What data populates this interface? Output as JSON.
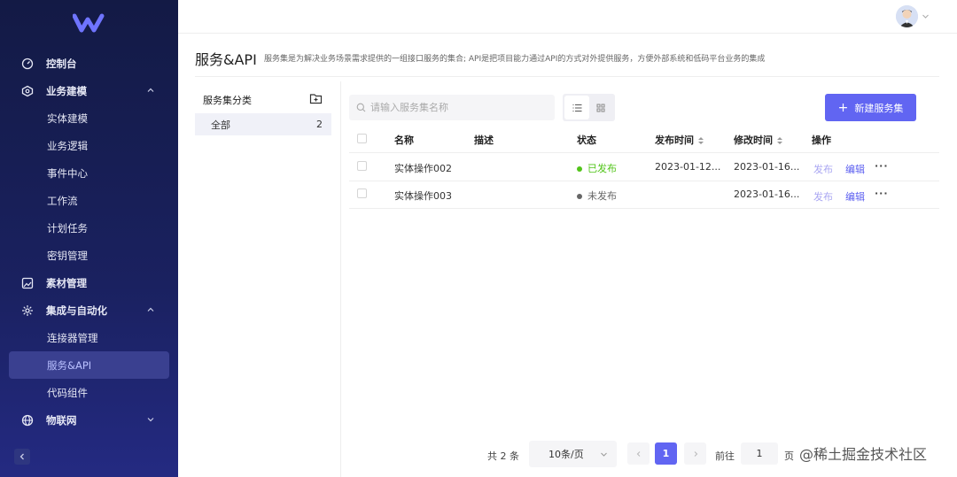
{
  "sidebar": {
    "items": [
      {
        "label": "控制台",
        "icon": "dashboard-icon",
        "type": "group"
      },
      {
        "label": "业务建模",
        "icon": "model-icon",
        "type": "group",
        "expanded": true
      },
      {
        "label": "实体建模",
        "type": "sub"
      },
      {
        "label": "业务逻辑",
        "type": "sub"
      },
      {
        "label": "事件中心",
        "type": "sub"
      },
      {
        "label": "工作流",
        "type": "sub"
      },
      {
        "label": "计划任务",
        "type": "sub"
      },
      {
        "label": "密钥管理",
        "type": "sub"
      },
      {
        "label": "素材管理",
        "icon": "image-icon",
        "type": "group"
      },
      {
        "label": "集成与自动化",
        "icon": "integration-icon",
        "type": "group",
        "expanded": true
      },
      {
        "label": "连接器管理",
        "type": "sub"
      },
      {
        "label": "服务&API",
        "type": "sub",
        "active": true
      },
      {
        "label": "代码组件",
        "type": "sub"
      },
      {
        "label": "物联网",
        "icon": "globe-icon",
        "type": "group",
        "expanded": false
      }
    ]
  },
  "page": {
    "title": "服务&API",
    "description": "服务集是为解决业务场景需求提供的一组接口服务的集合; API是把项目能力通过API的方式对外提供服务，方便外部系统和低码平台业务的集成"
  },
  "categories": {
    "title": "服务集分类",
    "items": [
      {
        "label": "全部",
        "count": "2"
      }
    ]
  },
  "toolbar": {
    "search_placeholder": "请输入服务集名称",
    "new_button": "新建服务集"
  },
  "table": {
    "headers": {
      "name": "名称",
      "desc": "描述",
      "status": "状态",
      "published": "发布时间",
      "modified": "修改时间",
      "actions": "操作"
    },
    "rows": [
      {
        "name": "实体操作002",
        "desc": "",
        "status": "已发布",
        "status_color": "#52c41a",
        "published": "2023-01-12...",
        "modified": "2023-01-16...",
        "pub": "发布",
        "edit": "编辑",
        "more": "···"
      },
      {
        "name": "实体操作003",
        "desc": "",
        "status": "未发布",
        "status_color": "#666666",
        "published": "",
        "modified": "2023-01-16...",
        "pub": "发布",
        "edit": "编辑",
        "more": "···"
      }
    ]
  },
  "pagination": {
    "total": "共 2 条",
    "page_size": "10条/页",
    "current": "1",
    "goto_label": "前往",
    "goto_value": "1",
    "goto_unit": "页"
  },
  "watermark": "@稀土掘金技术社区",
  "colors": {
    "accent": "#6165f2",
    "sidebar": "#1a2160",
    "published": "#52c41a"
  }
}
